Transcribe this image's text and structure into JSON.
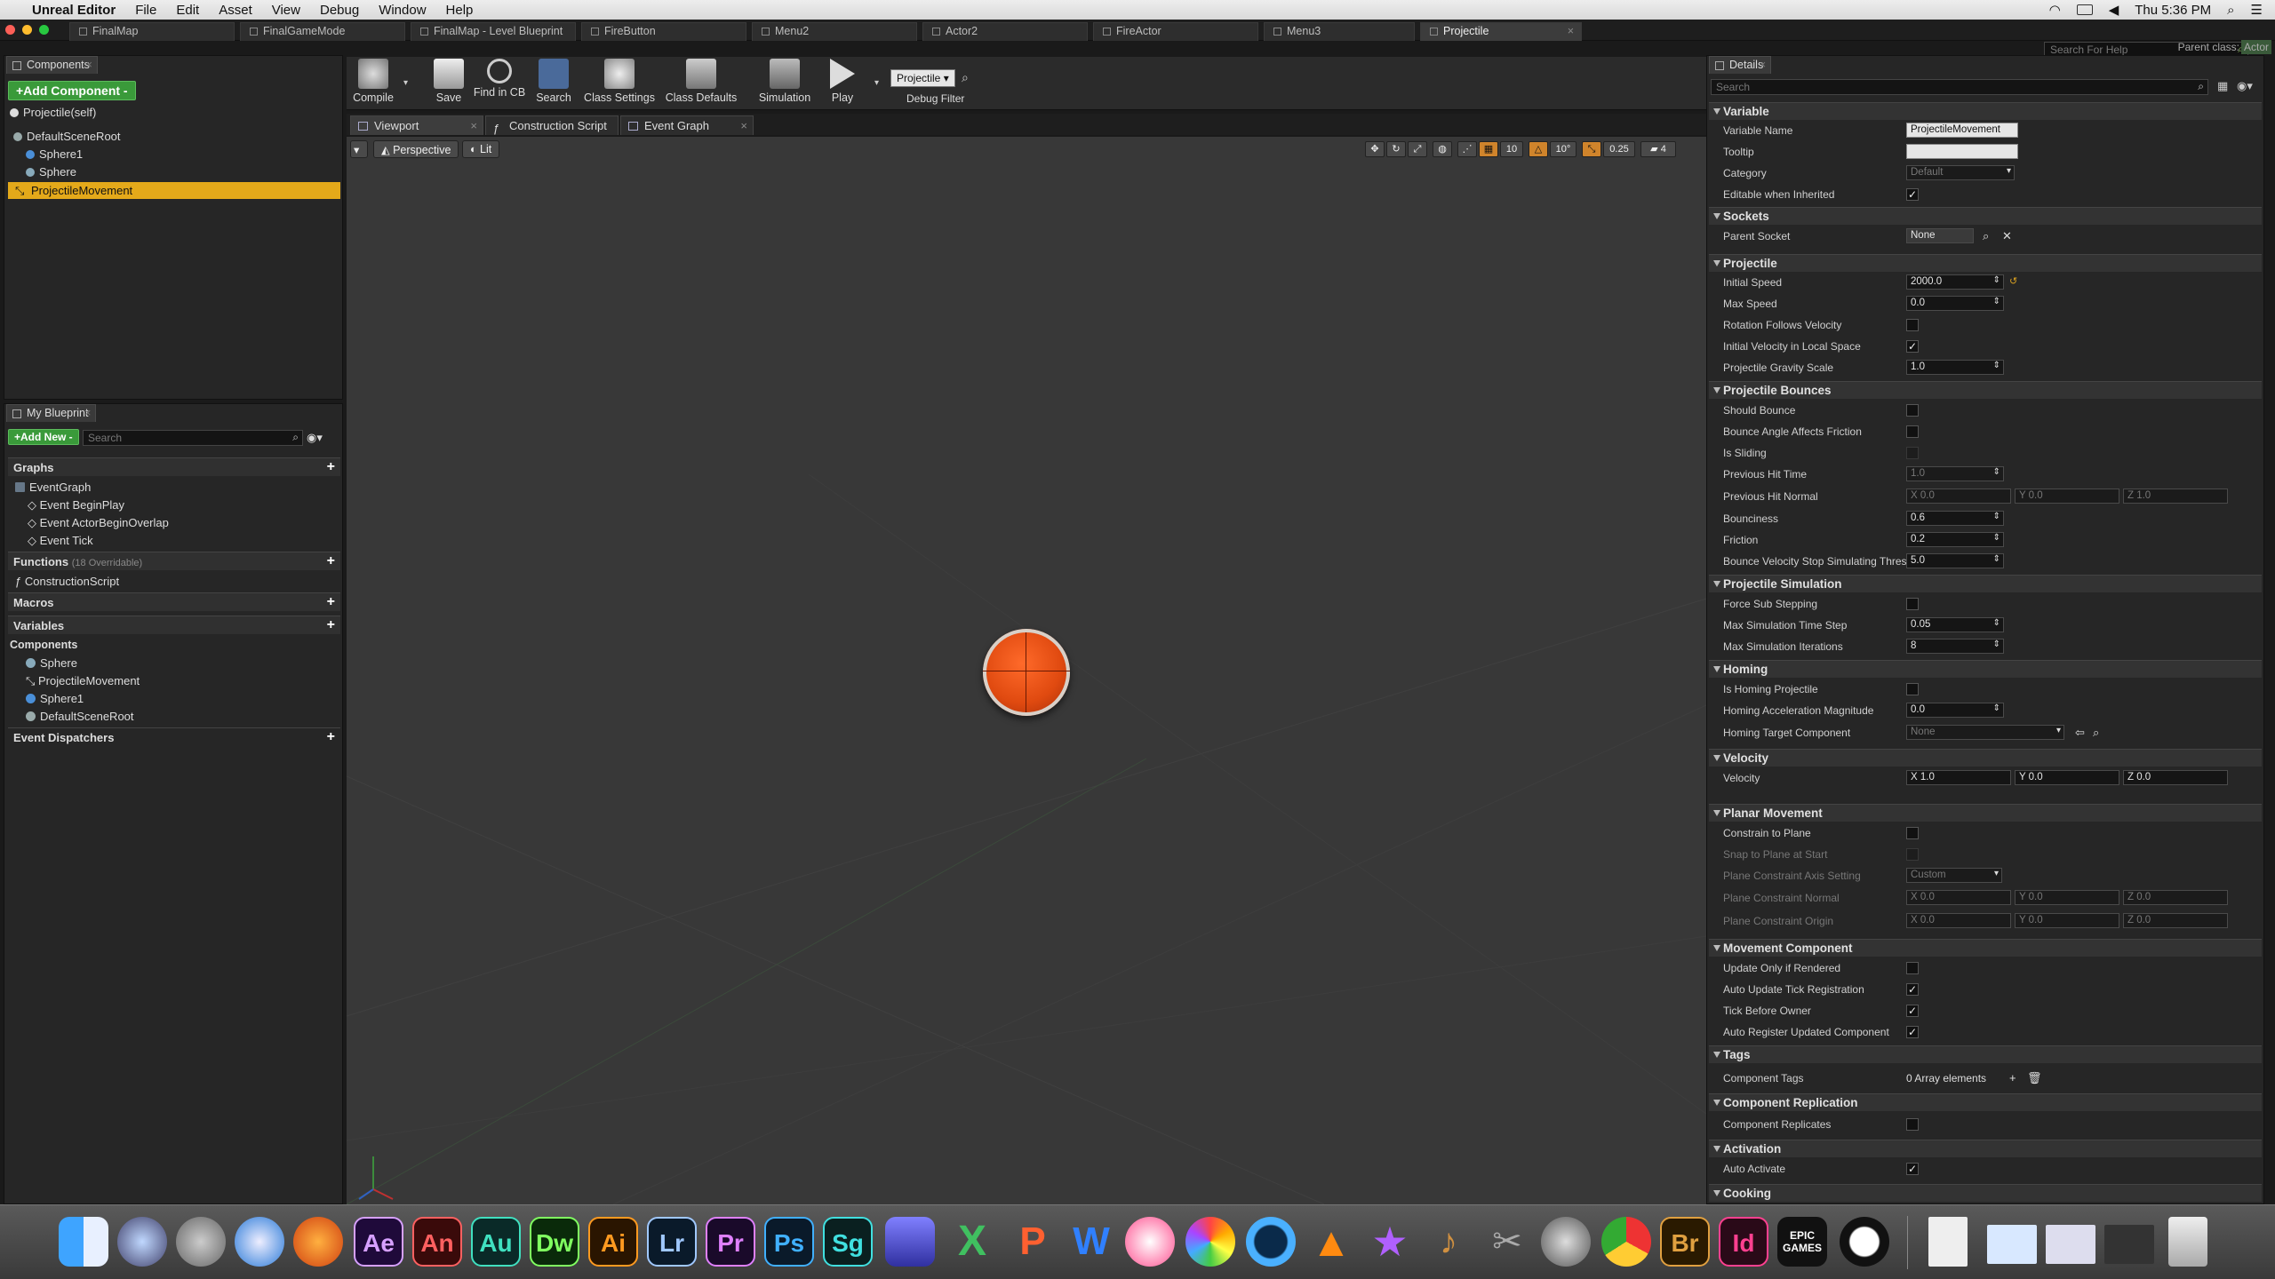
{
  "menubar": {
    "app_name": "Unreal Editor",
    "menus": [
      "File",
      "Edit",
      "Asset",
      "View",
      "Debug",
      "Window",
      "Help"
    ],
    "clock": "Thu 5:36 PM"
  },
  "doc_tabs": [
    "FinalMap",
    "FinalGameMode",
    "FinalMap - Level Blueprint",
    "FireButton",
    "Menu2",
    "Actor2",
    "FireActor",
    "Menu3",
    "Projectile"
  ],
  "help_search_placeholder": "Search For Help",
  "parent_class_label": "Parent class:",
  "parent_class_value": "Actor",
  "components_panel": {
    "tab": "Components",
    "add_button": "+Add Component -",
    "self_row": "Projectile(self)",
    "tree": [
      "DefaultSceneRoot",
      "Sphere1",
      "Sphere",
      "ProjectileMovement"
    ],
    "selected": "ProjectileMovement"
  },
  "my_blueprint": {
    "tab": "My Blueprint",
    "add_new": "+Add New -",
    "search_placeholder": "Search",
    "graphs_label": "Graphs",
    "graphs": [
      "EventGraph",
      "Event BeginPlay",
      "Event ActorBeginOverlap",
      "Event Tick"
    ],
    "functions_label": "Functions",
    "functions_count": "(18 Overridable)",
    "functions": [
      "ConstructionScript"
    ],
    "macros_label": "Macros",
    "variables_label": "Variables",
    "components_label": "Components",
    "component_vars": [
      "Sphere",
      "ProjectileMovement",
      "Sphere1",
      "DefaultSceneRoot"
    ],
    "event_dispatchers_label": "Event Dispatchers"
  },
  "toolbar": {
    "compile": "Compile",
    "save": "Save",
    "find": "Find in CB",
    "search": "Search",
    "class_settings": "Class Settings",
    "class_defaults": "Class Defaults",
    "simulation": "Simulation",
    "play": "Play",
    "debug_value": "Projectile",
    "debug_label": "Debug Filter"
  },
  "editor_tabs": [
    "Viewport",
    "Construction Script",
    "Event Graph"
  ],
  "viewport": {
    "perspective": "Perspective",
    "lit": "Lit",
    "grid_snap": "10",
    "rot_snap": "10°",
    "scale_snap": "0.25",
    "cam_speed": "4"
  },
  "details": {
    "tab": "Details",
    "search_placeholder": "Search",
    "sections": {
      "variable": "Variable",
      "sockets": "Sockets",
      "projectile": "Projectile",
      "bounces": "Projectile Bounces",
      "simulation": "Projectile Simulation",
      "homing": "Homing",
      "velocity": "Velocity",
      "planar": "Planar Movement",
      "movement": "Movement Component",
      "tags": "Tags",
      "replication": "Component Replication",
      "activation": "Activation",
      "cooking": "Cooking"
    },
    "labels": {
      "variable_name": "Variable Name",
      "tooltip": "Tooltip",
      "category": "Category",
      "editable_inherited": "Editable when Inherited",
      "parent_socket": "Parent Socket",
      "initial_speed": "Initial Speed",
      "max_speed": "Max Speed",
      "rotation_follows": "Rotation Follows Velocity",
      "initial_local": "Initial Velocity in Local Space",
      "gravity_scale": "Projectile Gravity Scale",
      "should_bounce": "Should Bounce",
      "bounce_angle": "Bounce Angle Affects Friction",
      "is_sliding": "Is Sliding",
      "prev_hit_time": "Previous Hit Time",
      "prev_hit_normal": "Previous Hit Normal",
      "bounciness": "Bounciness",
      "friction": "Friction",
      "bounce_stop": "Bounce Velocity Stop Simulating Threshold",
      "force_sub": "Force Sub Stepping",
      "max_time_step": "Max Simulation Time Step",
      "max_iter": "Max Simulation Iterations",
      "is_homing": "Is Homing Projectile",
      "homing_accel": "Homing Acceleration Magnitude",
      "homing_target": "Homing Target Component",
      "velocity": "Velocity",
      "constrain_plane": "Constrain to Plane",
      "snap_plane": "Snap to Plane at Start",
      "plane_axis": "Plane Constraint Axis Setting",
      "plane_normal": "Plane Constraint Normal",
      "plane_origin": "Plane Constraint Origin",
      "update_rendered": "Update Only if Rendered",
      "auto_update_tick": "Auto Update Tick Registration",
      "tick_before": "Tick Before Owner",
      "auto_register": "Auto Register Updated Component",
      "component_tags": "Component Tags",
      "replicates": "Component Replicates",
      "auto_activate": "Auto Activate"
    },
    "values": {
      "variable_name": "ProjectileMovement",
      "tooltip": "",
      "category": "Default",
      "parent_socket": "None",
      "initial_speed": "2000.0",
      "max_speed": "0.0",
      "gravity_scale": "1.0",
      "prev_hit_time": "1.0",
      "prev_hit_normal": {
        "x": "X 0.0",
        "y": "Y 0.0",
        "z": "Z 1.0"
      },
      "bounciness": "0.6",
      "friction": "0.2",
      "bounce_stop": "5.0",
      "max_time_step": "0.05",
      "max_iter": "8",
      "homing_accel": "0.0",
      "homing_target": "None",
      "velocity": {
        "x": "X 1.0",
        "y": "Y 0.0",
        "z": "Z 0.0"
      },
      "plane_axis": "Custom",
      "plane_normal": {
        "x": "X 0.0",
        "y": "Y 0.0",
        "z": "Z 0.0"
      },
      "plane_origin": {
        "x": "X 0.0",
        "y": "Y 0.0",
        "z": "Z 0.0"
      },
      "component_tags": "0 Array elements"
    }
  },
  "dock": {
    "apps": [
      "Finder",
      "Siri",
      "Launchpad",
      "Safari",
      "Firefox",
      "Ae",
      "An",
      "Au",
      "Dw",
      "Ai",
      "Lr",
      "Pr",
      "Ps",
      "Sg",
      "iMovie",
      "X",
      "Pages",
      "W",
      "iTunes",
      "Photos",
      "QuickTime",
      "VLC",
      "iMovie Star",
      "GarageBand",
      "Final Cut",
      "System Preferences",
      "Chrome",
      "Br",
      "Id",
      "EPIC GAMES",
      "Unreal"
    ]
  }
}
